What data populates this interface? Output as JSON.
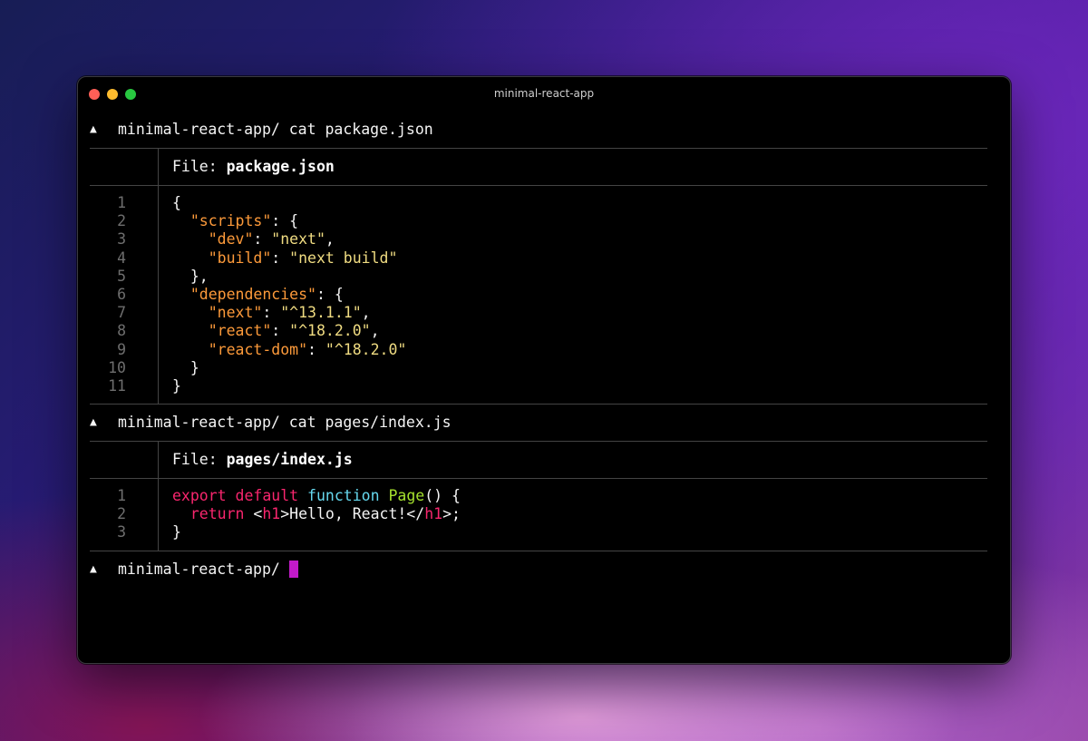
{
  "window": {
    "title": "minimal-react-app"
  },
  "prompt_symbol": "▲",
  "commands": [
    {
      "dir": "minimal-react-app/",
      "cmd": "cat package.json",
      "file_label": "File: ",
      "file_name": "package.json",
      "lines": [
        {
          "n": "1",
          "tokens": [
            {
              "t": "{",
              "c": "punct"
            }
          ]
        },
        {
          "n": "2",
          "tokens": [
            {
              "t": "  ",
              "c": "punct"
            },
            {
              "t": "\"scripts\"",
              "c": "key"
            },
            {
              "t": ": {",
              "c": "punct"
            }
          ]
        },
        {
          "n": "3",
          "tokens": [
            {
              "t": "    ",
              "c": "punct"
            },
            {
              "t": "\"dev\"",
              "c": "key"
            },
            {
              "t": ": ",
              "c": "punct"
            },
            {
              "t": "\"next\"",
              "c": "str"
            },
            {
              "t": ",",
              "c": "punct"
            }
          ]
        },
        {
          "n": "4",
          "tokens": [
            {
              "t": "    ",
              "c": "punct"
            },
            {
              "t": "\"build\"",
              "c": "key"
            },
            {
              "t": ": ",
              "c": "punct"
            },
            {
              "t": "\"next build\"",
              "c": "str"
            }
          ]
        },
        {
          "n": "5",
          "tokens": [
            {
              "t": "  },",
              "c": "punct"
            }
          ]
        },
        {
          "n": "6",
          "tokens": [
            {
              "t": "  ",
              "c": "punct"
            },
            {
              "t": "\"dependencies\"",
              "c": "key"
            },
            {
              "t": ": {",
              "c": "punct"
            }
          ]
        },
        {
          "n": "7",
          "tokens": [
            {
              "t": "    ",
              "c": "punct"
            },
            {
              "t": "\"next\"",
              "c": "key"
            },
            {
              "t": ": ",
              "c": "punct"
            },
            {
              "t": "\"^13.1.1\"",
              "c": "str"
            },
            {
              "t": ",",
              "c": "punct"
            }
          ]
        },
        {
          "n": "8",
          "tokens": [
            {
              "t": "    ",
              "c": "punct"
            },
            {
              "t": "\"react\"",
              "c": "key"
            },
            {
              "t": ": ",
              "c": "punct"
            },
            {
              "t": "\"^18.2.0\"",
              "c": "str"
            },
            {
              "t": ",",
              "c": "punct"
            }
          ]
        },
        {
          "n": "9",
          "tokens": [
            {
              "t": "    ",
              "c": "punct"
            },
            {
              "t": "\"react-dom\"",
              "c": "key"
            },
            {
              "t": ": ",
              "c": "punct"
            },
            {
              "t": "\"^18.2.0\"",
              "c": "str"
            }
          ]
        },
        {
          "n": "10",
          "tokens": [
            {
              "t": "  }",
              "c": "punct"
            }
          ]
        },
        {
          "n": "11",
          "tokens": [
            {
              "t": "}",
              "c": "punct"
            }
          ]
        }
      ]
    },
    {
      "dir": "minimal-react-app/",
      "cmd": "cat pages/index.js",
      "file_label": "File: ",
      "file_name": "pages/index.js",
      "lines": [
        {
          "n": "1",
          "tokens": [
            {
              "t": "export",
              "c": "kw"
            },
            {
              "t": " ",
              "c": "text"
            },
            {
              "t": "default",
              "c": "kw"
            },
            {
              "t": " ",
              "c": "text"
            },
            {
              "t": "function",
              "c": "fn-kw"
            },
            {
              "t": " ",
              "c": "text"
            },
            {
              "t": "Page",
              "c": "fn"
            },
            {
              "t": "() {",
              "c": "text"
            }
          ]
        },
        {
          "n": "2",
          "tokens": [
            {
              "t": "  ",
              "c": "text"
            },
            {
              "t": "return",
              "c": "kw"
            },
            {
              "t": " <",
              "c": "text"
            },
            {
              "t": "h1",
              "c": "tag"
            },
            {
              "t": ">Hello, React!</",
              "c": "text"
            },
            {
              "t": "h1",
              "c": "tag"
            },
            {
              "t": ">;",
              "c": "text"
            }
          ]
        },
        {
          "n": "3",
          "tokens": [
            {
              "t": "}",
              "c": "text"
            }
          ]
        }
      ]
    }
  ],
  "final_prompt": {
    "dir": "minimal-react-app/"
  },
  "colors": {
    "background": "#000000",
    "cursor": "#c21ac9",
    "json_key": "#fd9a3a",
    "json_string": "#f0dc82",
    "keyword": "#f9266e",
    "function_keyword": "#66d9ef",
    "function_name": "#a6e22e",
    "line_number": "#6e6e6e"
  }
}
